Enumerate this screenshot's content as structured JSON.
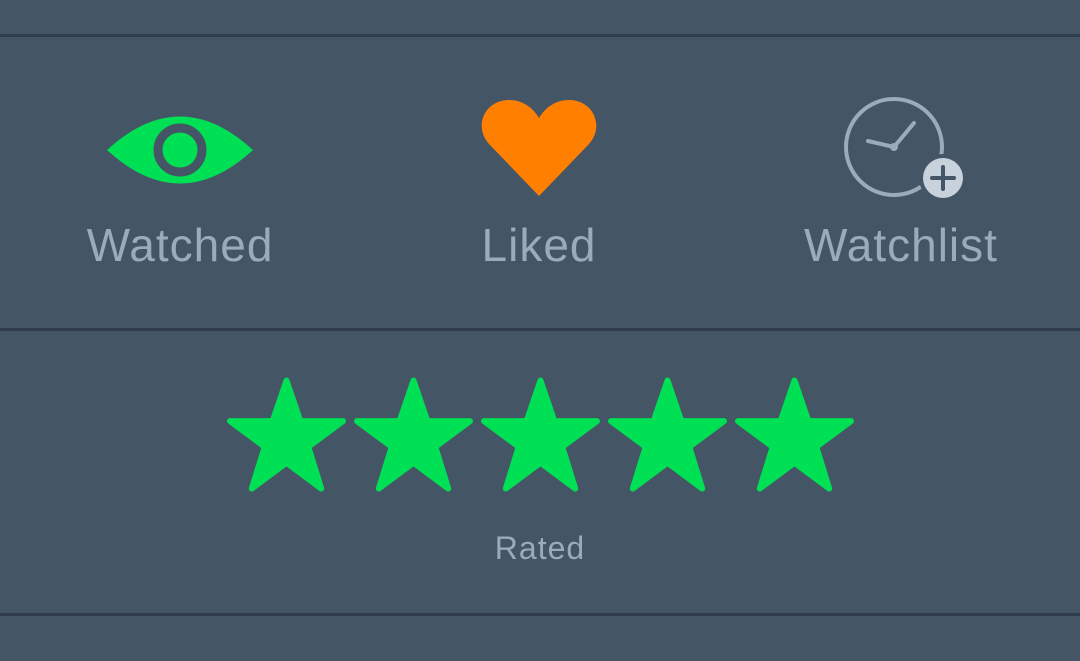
{
  "actions": {
    "watched": {
      "label": "Watched",
      "icon": "eye-icon",
      "color": "#00e054",
      "active": true
    },
    "liked": {
      "label": "Liked",
      "icon": "heart-icon",
      "color": "#ff8000",
      "active": true
    },
    "watchlist": {
      "label": "Watchlist",
      "icon": "clock-plus-icon",
      "color": "#9aabbb",
      "active": false
    }
  },
  "rating": {
    "value": 5,
    "max": 5,
    "label": "Rated",
    "star_color": "#00e054"
  }
}
